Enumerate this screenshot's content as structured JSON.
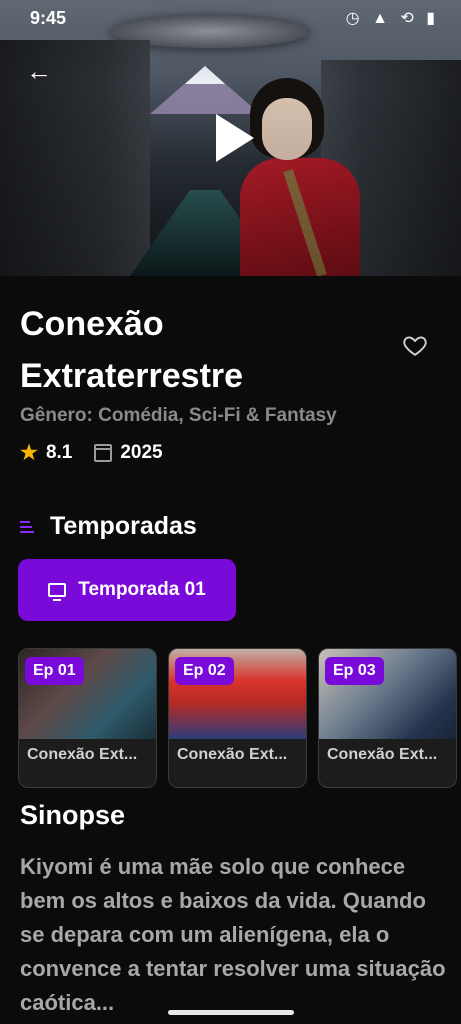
{
  "status": {
    "time": "9:45",
    "icons": "◷ ▲ ⟲ ▮"
  },
  "hero": {
    "back_icon": "arrow-left-icon",
    "play_icon": "play-icon"
  },
  "show": {
    "title": "Conexão Extraterrestre",
    "genre": "Gênero: Comédia, Sci-Fi & Fantasy",
    "rating": "8.1",
    "year": "2025",
    "favorite_icon": "heart-outline-icon"
  },
  "seasons": {
    "heading": "Temporadas",
    "selected": "Temporada 01",
    "accent": "#7a0ad9"
  },
  "episodes": [
    {
      "tag": "Ep 01",
      "title": "Conexão Ext..."
    },
    {
      "tag": "Ep 02",
      "title": "Conexão Ext..."
    },
    {
      "tag": "Ep 03",
      "title": "Conexão Ext..."
    }
  ],
  "synopsis": {
    "heading": "Sinopse",
    "text": "Kiyomi é uma mãe solo que conhece bem os altos e baixos da vida. Quando se depara com um alienígena, ela o convence a tentar resolver uma situação caótica..."
  }
}
